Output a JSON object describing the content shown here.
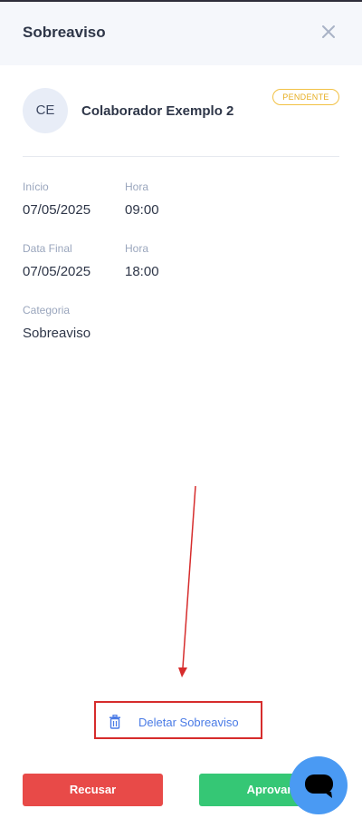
{
  "header": {
    "title": "Sobreaviso",
    "close_icon": "close-icon"
  },
  "employee": {
    "initials": "CE",
    "name": "Colaborador Exemplo 2",
    "status": "PENDENTE",
    "status_color": "#e6ad1f"
  },
  "fields": {
    "start_label": "Início",
    "start_date": "07/05/2025",
    "start_hour_label": "Hora",
    "start_hour": "09:00",
    "end_label": "Data Final",
    "end_date": "07/05/2025",
    "end_hour_label": "Hora",
    "end_hour": "18:00",
    "category_label": "Categoria",
    "category": "Sobreaviso"
  },
  "actions": {
    "delete_label": "Deletar Sobreaviso",
    "delete_icon": "trash-icon",
    "refuse_label": "Recusar",
    "approve_label": "Aprovar",
    "refuse_color": "#e84a48",
    "approve_color": "#35c775",
    "chat_icon": "chat-icon",
    "annotation_color": "#d62c2c"
  }
}
